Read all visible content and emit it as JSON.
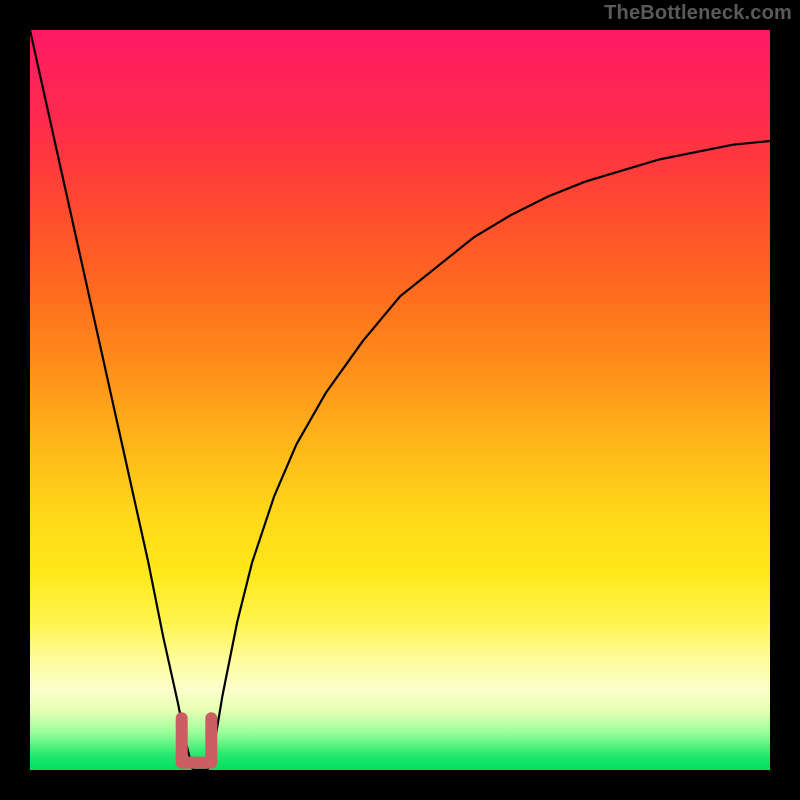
{
  "watermark": "TheBottleneck.com",
  "chart_data": {
    "type": "line",
    "title": "",
    "xlabel": "",
    "ylabel": "",
    "xlim": [
      0,
      100
    ],
    "ylim": [
      0,
      100
    ],
    "series": [
      {
        "name": "bottleneck-curve",
        "x": [
          0,
          2,
          4,
          6,
          8,
          10,
          12,
          14,
          16,
          18,
          20,
          21,
          22,
          23,
          24,
          25,
          26,
          28,
          30,
          33,
          36,
          40,
          45,
          50,
          55,
          60,
          65,
          70,
          75,
          80,
          85,
          90,
          95,
          100
        ],
        "y": [
          100,
          91,
          82,
          73,
          64,
          55,
          46,
          37,
          28,
          18,
          9,
          4,
          0,
          0,
          0,
          4,
          10,
          20,
          28,
          37,
          44,
          51,
          58,
          64,
          68,
          72,
          75,
          77.5,
          79.5,
          81,
          82.5,
          83.5,
          84.5,
          85
        ]
      }
    ],
    "notch": {
      "x_center": 22.5,
      "x_left": 20.5,
      "x_right": 24.5,
      "y_top": 7,
      "y_bottom": 1
    },
    "colors": {
      "curve": "#000000",
      "notch": "#cc5d63",
      "gradient_top": "#ff1a66",
      "gradient_bottom": "#00e060",
      "frame": "#000000"
    }
  }
}
